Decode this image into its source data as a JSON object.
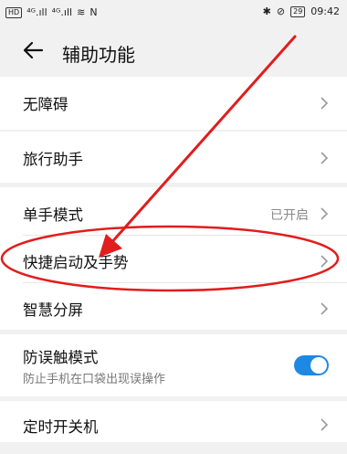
{
  "status_bar": {
    "left_chip": "HD",
    "signal1": "⁴ᴳ.ıll",
    "signal2": "⁴ᴳ.ıll",
    "wifi": "≋",
    "nfc": "N",
    "bluetooth": "✱",
    "mute": "⊘",
    "battery": "29",
    "time": "09:42"
  },
  "header": {
    "title": "辅助功能"
  },
  "items": {
    "accessibility": {
      "label": "无障碍"
    },
    "travel": {
      "label": "旅行助手"
    },
    "one_hand": {
      "label": "单手模式",
      "value": "已开启"
    },
    "shortcuts": {
      "label": "快捷启动及手势"
    },
    "split": {
      "label": "智慧分屏"
    },
    "mistouch": {
      "label": "防误触模式",
      "sub": "防止手机在口袋出现误操作",
      "toggle_on": true
    },
    "timer": {
      "label": "定时开关机"
    }
  },
  "annotation": {
    "color": "#e11d1d"
  },
  "accent": "#1e88e5"
}
